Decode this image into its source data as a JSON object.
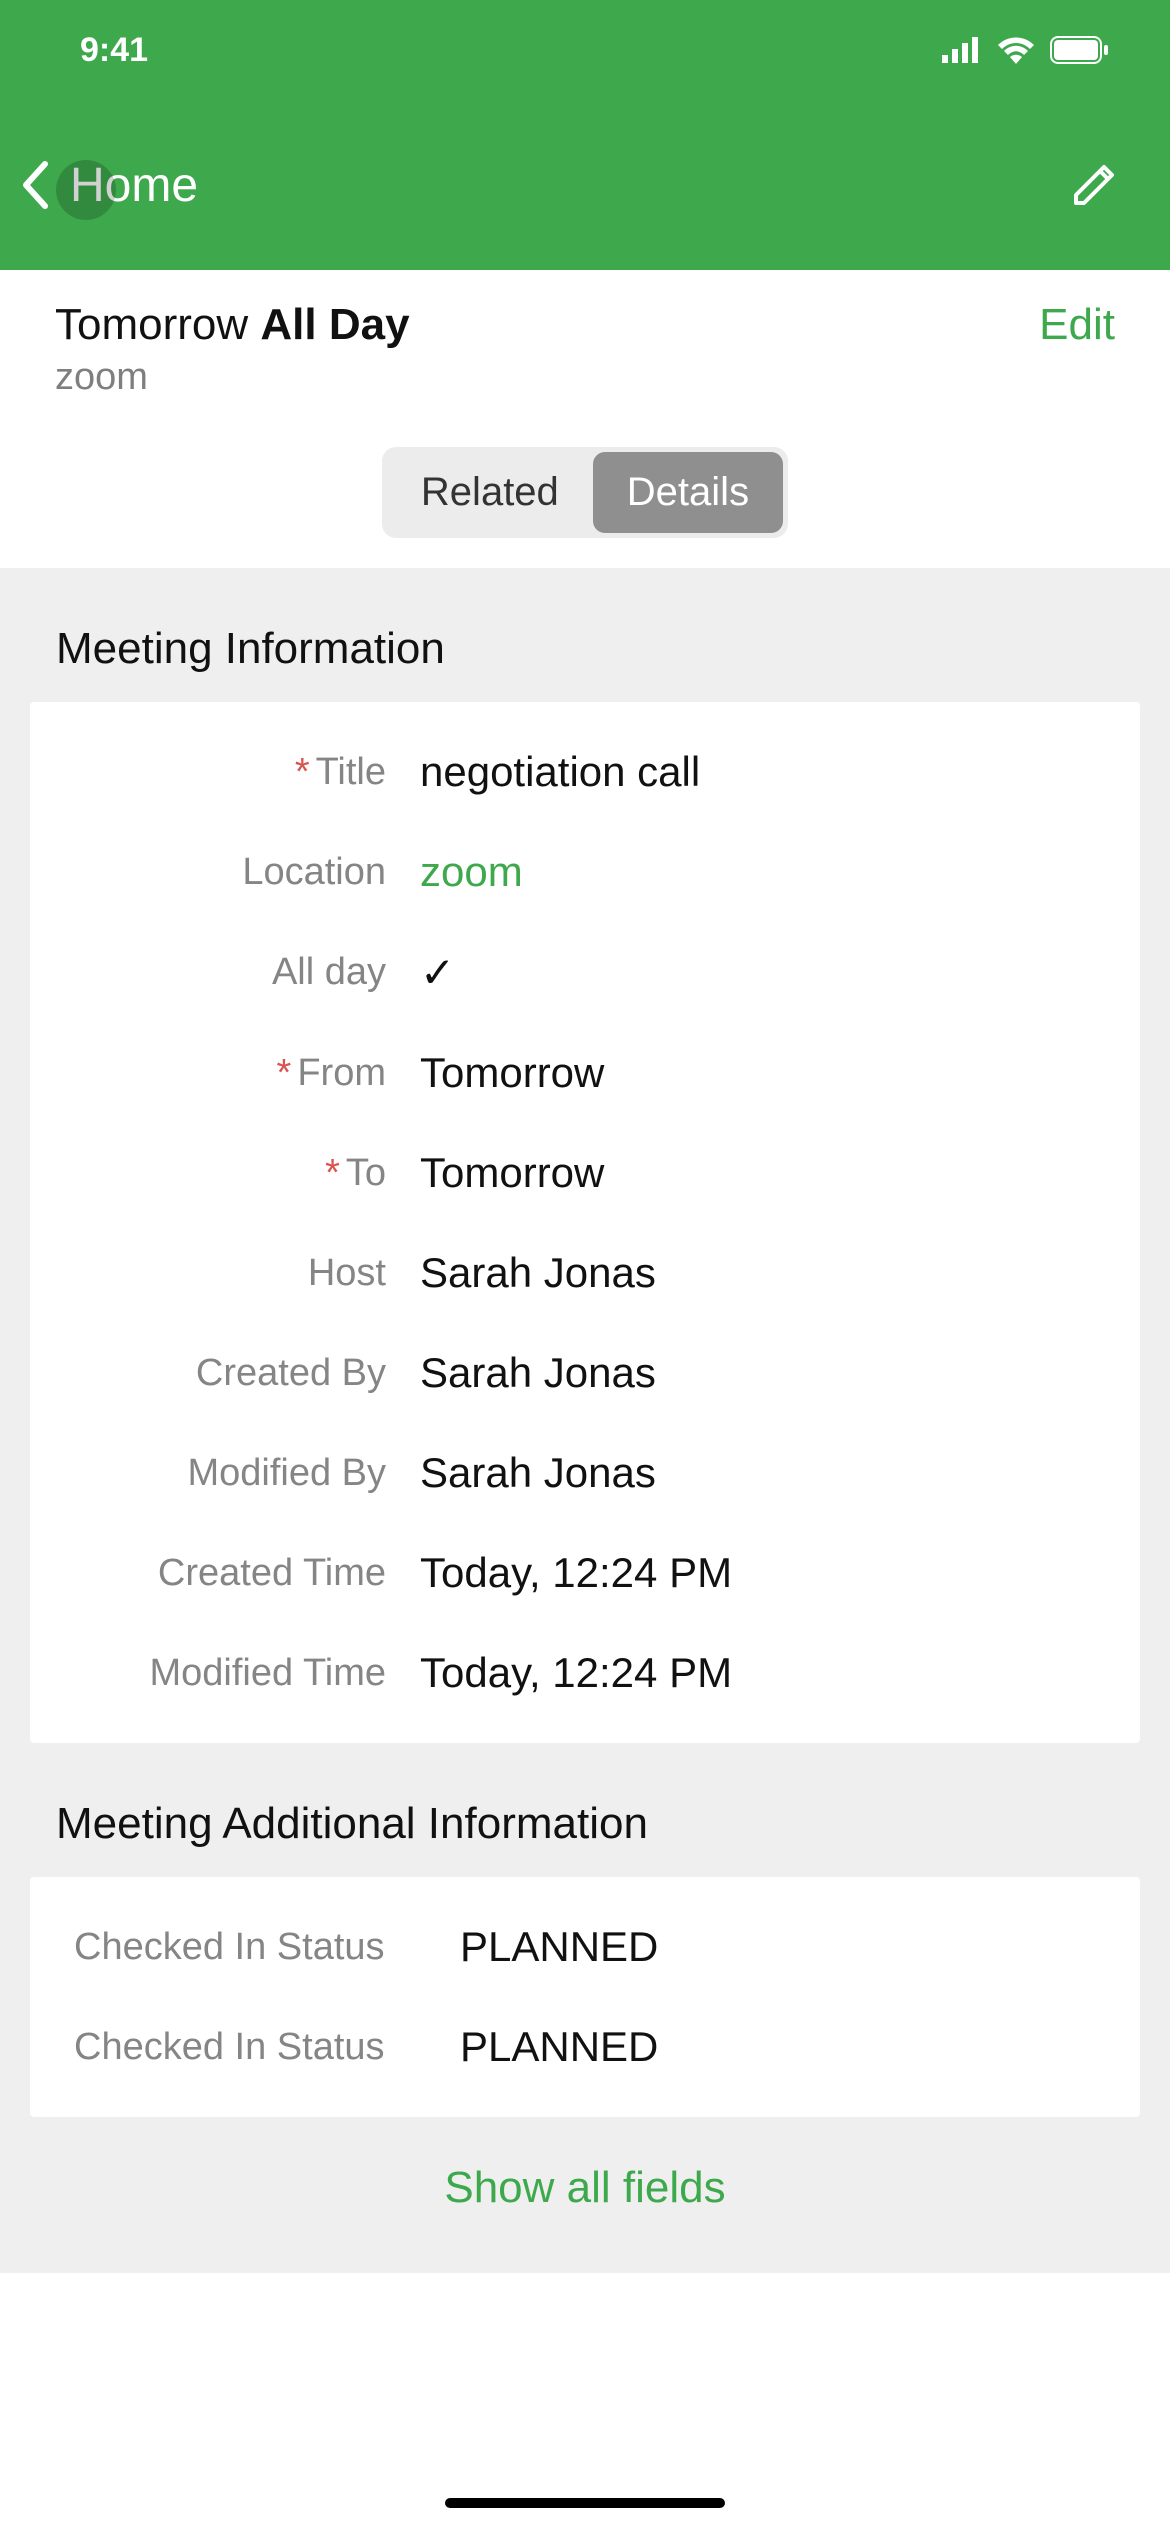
{
  "statusbar": {
    "time": "9:41"
  },
  "nav": {
    "back_label": "Home"
  },
  "summary": {
    "date_prefix": "Tomorrow ",
    "date_bold": "All Day",
    "subtitle": "zoom",
    "edit_label": "Edit"
  },
  "tabs": {
    "related": "Related",
    "details": "Details"
  },
  "section1": {
    "heading": "Meeting Information",
    "rows": {
      "title_label": "Title",
      "title_value": "negotiation call",
      "location_label": "Location",
      "location_value": "zoom",
      "allday_label": "All day",
      "from_label": "From",
      "from_value": "Tomorrow",
      "to_label": "To",
      "to_value": "Tomorrow",
      "host_label": "Host",
      "host_value": "Sarah Jonas",
      "createdby_label": "Created By",
      "createdby_value": "Sarah Jonas",
      "modifiedby_label": "Modified By",
      "modifiedby_value": "Sarah Jonas",
      "createdtime_label": "Created Time",
      "createdtime_value": "Today, 12:24 PM",
      "modifiedtime_label": "Modified Time",
      "modifiedtime_value": "Today, 12:24 PM"
    }
  },
  "section2": {
    "heading": "Meeting Additional Information",
    "rows": {
      "checkin1_label": "Checked In Status",
      "checkin1_value": "PLANNED",
      "checkin2_label": "Checked In Status",
      "checkin2_value": "PLANNED"
    }
  },
  "footer": {
    "show_all": "Show all fields"
  }
}
